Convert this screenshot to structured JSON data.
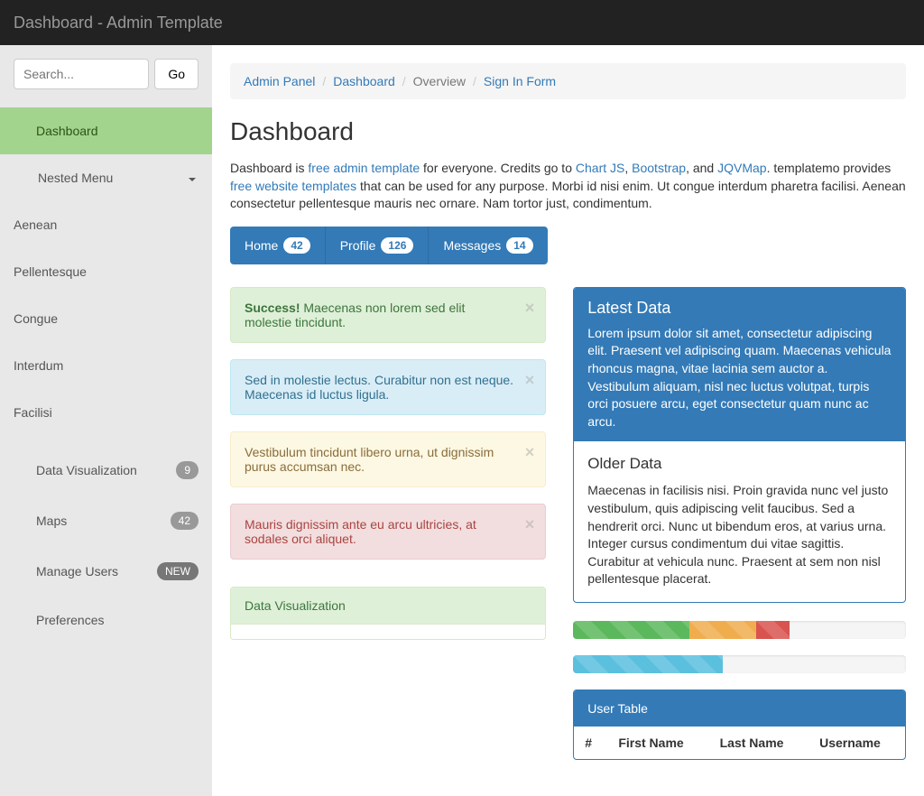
{
  "navbar": {
    "title": "Dashboard - Admin Template"
  },
  "search": {
    "placeholder": "Search...",
    "button": "Go"
  },
  "sidebar": {
    "dashboard": "Dashboard",
    "nested_menu": "Nested Menu",
    "sub": [
      "Aenean",
      "Pellentesque",
      "Congue",
      "Interdum",
      "Facilisi"
    ],
    "items": [
      {
        "label": "Data Visualization",
        "badge": "9"
      },
      {
        "label": "Maps",
        "badge": "42"
      },
      {
        "label": "Manage Users",
        "badge": "NEW"
      },
      {
        "label": "Preferences",
        "badge": ""
      }
    ]
  },
  "breadcrumb": [
    "Admin Panel",
    "Dashboard",
    "Overview",
    "Sign In Form"
  ],
  "page": {
    "title": "Dashboard",
    "intro_pre": "Dashboard is ",
    "link1": "free admin template",
    "intro_mid1": " for everyone. Credits go to ",
    "link2": "Chart JS",
    "comma": ", ",
    "link3": "Bootstrap",
    "and": ", and ",
    "link4": "JQVMap",
    "intro_mid2": ". templatemo provides ",
    "link5": "free website templates",
    "intro_post": " that can be used for any purpose. Morbi id nisi enim. Ut congue interdum pharetra facilisi. Aenean consectetur pellentesque mauris nec ornare. Nam tortor just, condimentum."
  },
  "tabs": [
    {
      "label": "Home",
      "count": "42"
    },
    {
      "label": "Profile",
      "count": "126"
    },
    {
      "label": "Messages",
      "count": "14"
    }
  ],
  "alerts": {
    "success_strong": "Success!",
    "success": " Maecenas non lorem sed elit molestie tincidunt.",
    "info": "Sed in molestie lectus. Curabitur non est neque. Maecenas id luctus ligula.",
    "warning": "Vestibulum tincidunt libero urna, ut dignissim purus accumsan nec.",
    "danger": "Mauris dignissim ante eu arcu ultricies, at sodales orci aliquet."
  },
  "latest": {
    "title": "Latest Data",
    "body": "Lorem ipsum dolor sit amet, consectetur adipiscing elit. Praesent vel adipiscing quam. Maecenas vehicula rhoncus magna, vitae lacinia sem auctor a. Vestibulum aliquam, nisl nec luctus volutpat, turpis orci posuere arcu, eget consectetur quam nunc ac arcu.",
    "older_title": "Older Data",
    "older_body": "Maecenas in facilisis nisi. Proin gravida nunc vel justo vestibulum, quis adipiscing velit faucibus. Sed a hendrerit orci. Nunc ut bibendum eros, at varius urna. Integer cursus condimentum dui vitae sagittis. Curabitur at vehicula nunc. Praesent at sem non nisl pellentesque placerat."
  },
  "progress": {
    "bar1": [
      {
        "color": "green",
        "width": 35
      },
      {
        "color": "orange",
        "width": 20
      },
      {
        "color": "red",
        "width": 10
      }
    ],
    "bar2": [
      {
        "color": "blue",
        "width": 45
      }
    ]
  },
  "dataviz_panel": "Data Visualization",
  "user_table": {
    "title": "User Table",
    "headers": [
      "#",
      "First Name",
      "Last Name",
      "Username"
    ]
  }
}
